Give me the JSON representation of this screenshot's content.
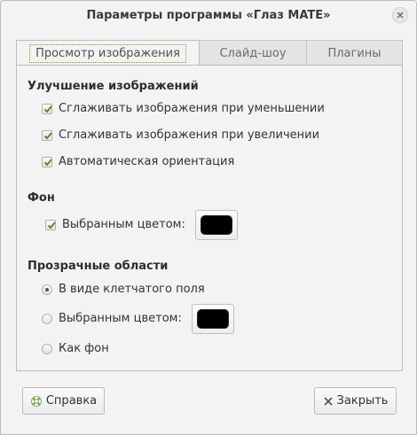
{
  "window": {
    "title": "Параметры программы «Глаз MATE»"
  },
  "tabs": [
    {
      "label": "Просмотр изображения",
      "active": true
    },
    {
      "label": "Слайд-шоу",
      "active": false
    },
    {
      "label": "Плагины",
      "active": false
    }
  ],
  "enhancement": {
    "title": "Улучшение изображений",
    "options": [
      {
        "label": "Сглаживать изображения при уменьшении",
        "checked": true
      },
      {
        "label": "Сглаживать изображения при увеличении",
        "checked": true
      },
      {
        "label": "Автоматическая ориентация",
        "checked": true
      }
    ]
  },
  "background": {
    "title": "Фон",
    "custom_color_label": "Выбранным цветом:",
    "custom_color_checked": true,
    "color": "#000000"
  },
  "transparency": {
    "title": "Прозрачные области",
    "options": [
      {
        "label": "В виде клетчатого поля",
        "selected": true
      },
      {
        "label": "Выбранным цветом:",
        "selected": false
      },
      {
        "label": "Как фон",
        "selected": false
      }
    ],
    "color": "#000000"
  },
  "buttons": {
    "help": "Справка",
    "close": "Закрыть"
  },
  "colors": {
    "accent": "#6a9c3a"
  }
}
